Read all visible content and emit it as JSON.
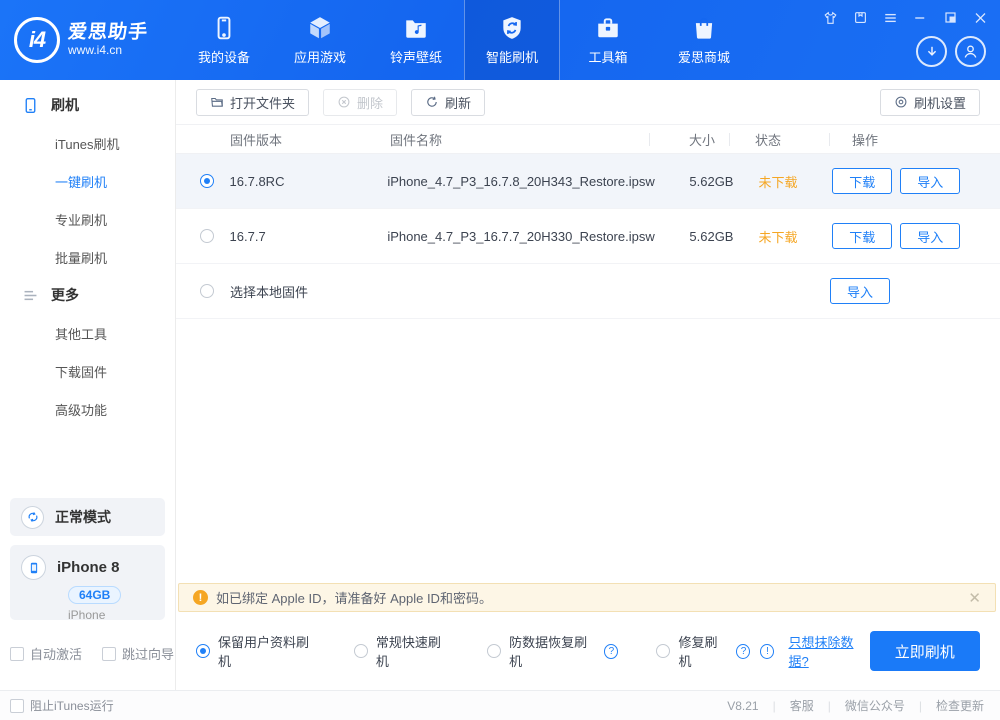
{
  "colors": {
    "header_blue": "#1467f0",
    "accent": "#2080f7",
    "warning_orange": "#f5a623"
  },
  "header": {
    "logo": {
      "badge": "i4",
      "brand": "爱思助手",
      "site": "www.i4.cn"
    },
    "nav": [
      {
        "label": "我的设备",
        "icon": "device-icon",
        "active": false
      },
      {
        "label": "应用游戏",
        "icon": "cube-icon",
        "active": false
      },
      {
        "label": "铃声壁纸",
        "icon": "ringtone-folder-icon",
        "active": false
      },
      {
        "label": "智能刷机",
        "icon": "shield-flash-icon",
        "active": true
      },
      {
        "label": "工具箱",
        "icon": "toolbox-icon",
        "active": false
      },
      {
        "label": "爱思商城",
        "icon": "shopping-bag-icon",
        "active": false
      }
    ]
  },
  "sidebar": {
    "sections": [
      {
        "title": "刷机",
        "items": [
          "iTunes刷机",
          "一键刷机",
          "专业刷机",
          "批量刷机"
        ],
        "active_item": "一键刷机"
      },
      {
        "title": "更多",
        "items": [
          "其他工具",
          "下载固件",
          "高级功能"
        ]
      }
    ],
    "mode_card": {
      "label": "正常模式"
    },
    "device": {
      "name": "iPhone 8",
      "capacity": "64GB",
      "type": "iPhone"
    },
    "checkboxes": [
      "自动激活",
      "跳过向导"
    ]
  },
  "toolbar": {
    "open_folder": "打开文件夹",
    "delete": "删除",
    "refresh": "刷新",
    "settings": "刷机设置"
  },
  "table": {
    "headers": [
      "固件版本",
      "固件名称",
      "大小",
      "状态",
      "操作"
    ],
    "rows": [
      {
        "version": "16.7.8RC",
        "name": "iPhone_4.7_P3_16.7.8_20H343_Restore.ipsw",
        "size": "5.62GB",
        "status": "未下载",
        "actions": [
          "下载",
          "导入"
        ],
        "selected": true
      },
      {
        "version": "16.7.7",
        "name": "iPhone_4.7_P3_16.7.7_20H330_Restore.ipsw",
        "size": "5.62GB",
        "status": "未下载",
        "actions": [
          "下载",
          "导入"
        ],
        "selected": false
      },
      {
        "version": "选择本地固件",
        "name": "",
        "size": "",
        "status": "",
        "actions": [
          "导入"
        ],
        "selected": false
      }
    ]
  },
  "notice": {
    "text": "如已绑定 Apple ID，请准备好 Apple ID和密码。",
    "close": "✕"
  },
  "options": {
    "items": [
      {
        "label": "保留用户资料刷机",
        "selected": true
      },
      {
        "label": "常规快速刷机",
        "selected": false
      },
      {
        "label": "防数据恢复刷机",
        "selected": false
      },
      {
        "label": "修复刷机",
        "selected": false
      }
    ],
    "help_q": "?",
    "help_i": "!",
    "erase_link": "只想抹除数据?",
    "flash_button": "立即刷机"
  },
  "statusbar": {
    "block_itunes": "阻止iTunes运行",
    "version": "V8.21",
    "links": [
      "客服",
      "微信公众号",
      "检查更新"
    ]
  }
}
